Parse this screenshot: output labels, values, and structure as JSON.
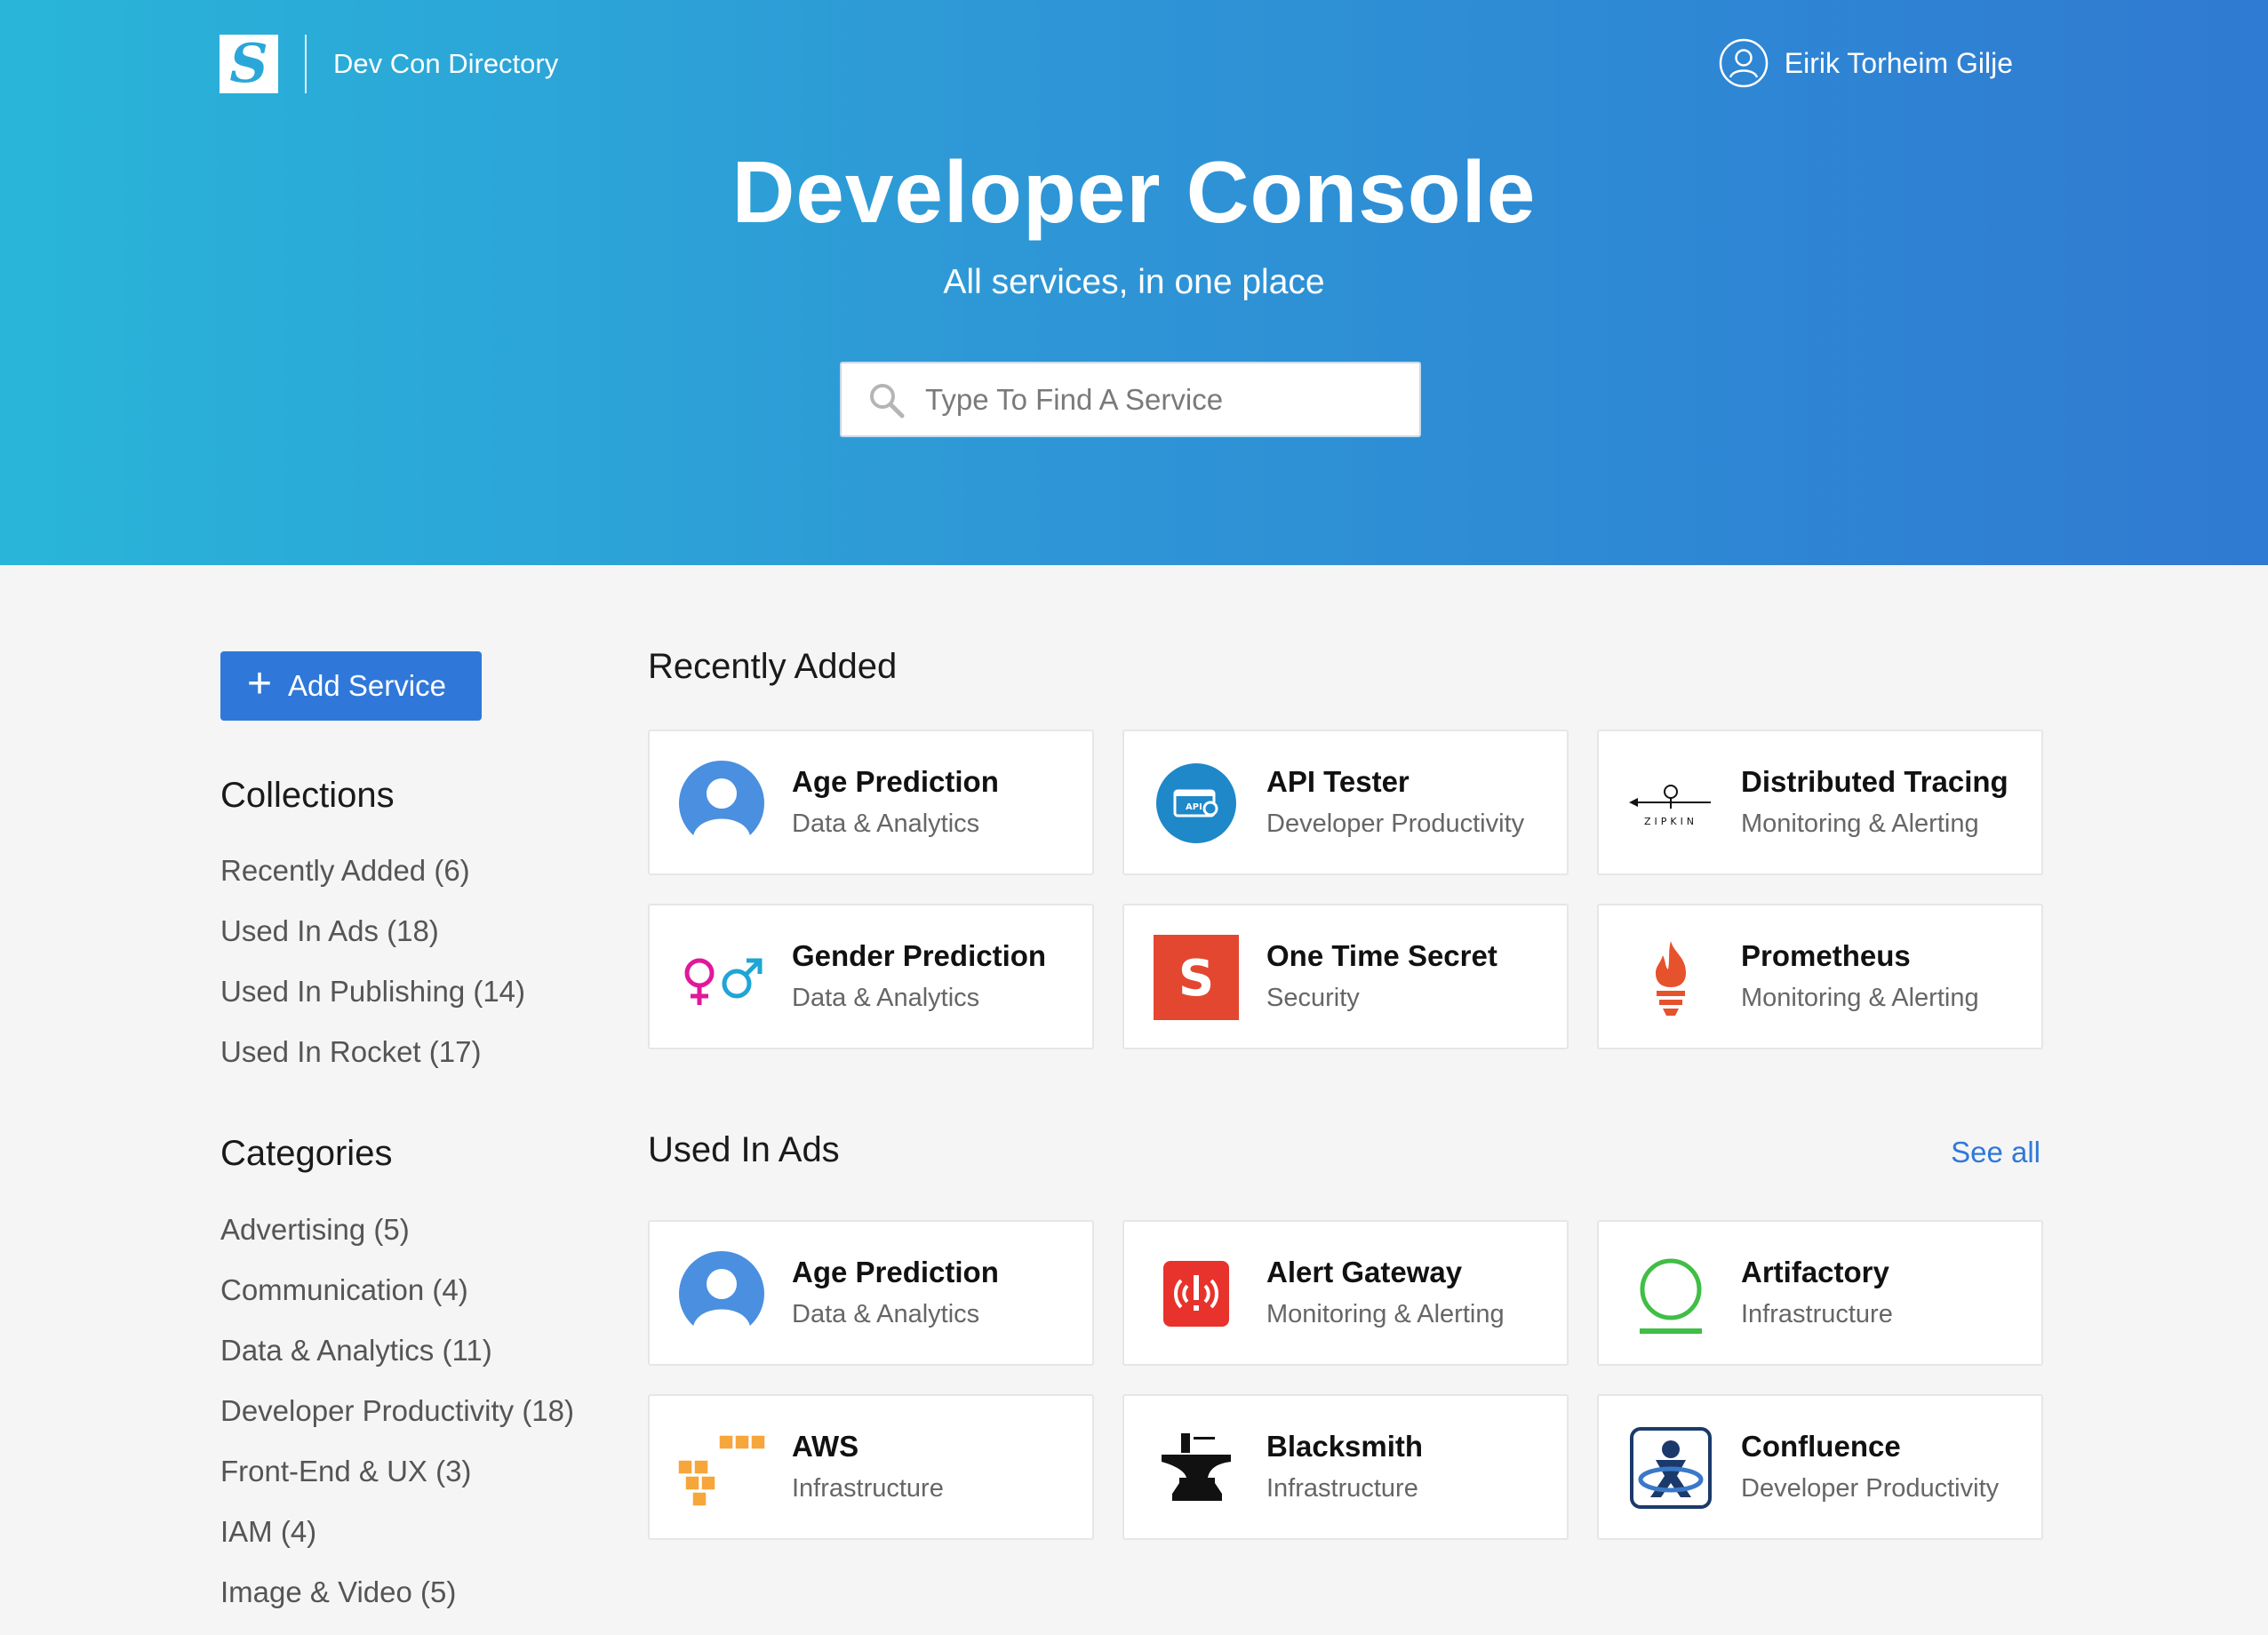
{
  "header": {
    "brand": "Dev Con Directory",
    "logo_letter": "S",
    "user_name": "Eirik Torheim Gilje"
  },
  "hero": {
    "title": "Developer Console",
    "subtitle": "All services, in one place",
    "search_placeholder": "Type To Find A Service"
  },
  "sidebar": {
    "add_button": "Add Service",
    "collections_title": "Collections",
    "collections": [
      {
        "label": "Recently Added (6)"
      },
      {
        "label": "Used In Ads (18)"
      },
      {
        "label": "Used In Publishing (14)"
      },
      {
        "label": "Used In Rocket (17)"
      }
    ],
    "categories_title": "Categories",
    "categories": [
      {
        "label": "Advertising (5)"
      },
      {
        "label": "Communication (4)"
      },
      {
        "label": "Data & Analytics (11)"
      },
      {
        "label": "Developer Productivity (18)"
      },
      {
        "label": "Front-End & UX (3)"
      },
      {
        "label": "IAM (4)"
      },
      {
        "label": "Image & Video (5)"
      }
    ]
  },
  "sections": {
    "recent": {
      "title": "Recently Added",
      "cards": [
        {
          "name": "Age Prediction",
          "category": "Data & Analytics",
          "icon": "avatar-icon"
        },
        {
          "name": "API Tester",
          "category": "Developer Productivity",
          "icon": "api-tester-icon"
        },
        {
          "name": "Distributed Tracing",
          "category": "Monitoring & Alerting",
          "icon": "zipkin-icon",
          "icon_text": "ZIPKIN"
        },
        {
          "name": "Gender Prediction",
          "category": "Data & Analytics",
          "icon": "gender-icon"
        },
        {
          "name": "One Time Secret",
          "category": "Security",
          "icon": "secret-icon",
          "icon_text": "S"
        },
        {
          "name": "Prometheus",
          "category": "Monitoring & Alerting",
          "icon": "prometheus-icon"
        }
      ]
    },
    "ads": {
      "title": "Used In Ads",
      "see_all": "See all",
      "cards": [
        {
          "name": "Age Prediction",
          "category": "Data & Analytics",
          "icon": "avatar-icon"
        },
        {
          "name": "Alert Gateway",
          "category": "Monitoring & Alerting",
          "icon": "alert-icon"
        },
        {
          "name": "Artifactory",
          "category": "Infrastructure",
          "icon": "artifactory-icon"
        },
        {
          "name": "AWS",
          "category": "Infrastructure",
          "icon": "aws-icon"
        },
        {
          "name": "Blacksmith",
          "category": "Infrastructure",
          "icon": "anvil-icon"
        },
        {
          "name": "Confluence",
          "category": "Developer Productivity",
          "icon": "confluence-icon"
        }
      ]
    }
  },
  "colors": {
    "hero_start": "#29b5d9",
    "hero_end": "#2f7ad2",
    "accent": "#2f78d9"
  }
}
